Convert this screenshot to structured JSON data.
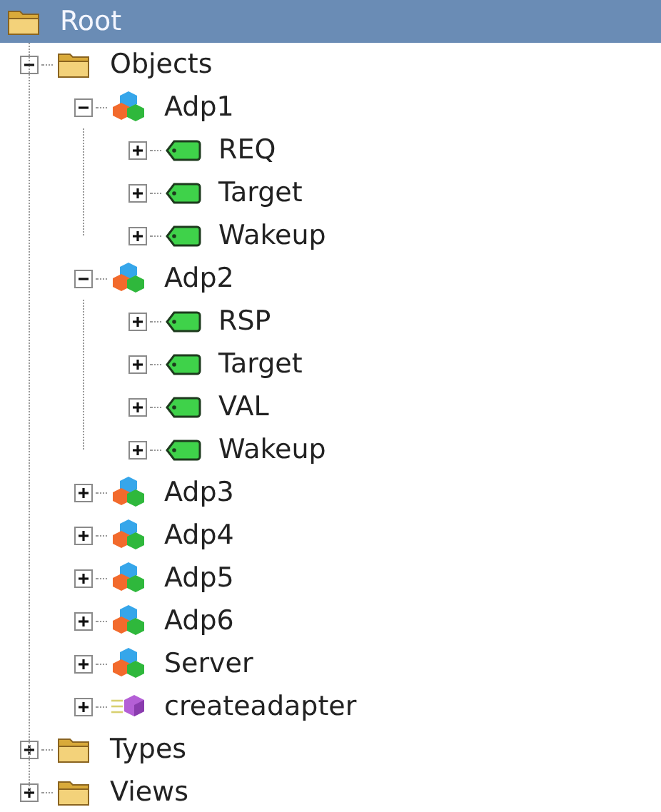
{
  "tree": {
    "label": "Root",
    "kind": "folder",
    "selected": true,
    "children": [
      {
        "label": "Objects",
        "kind": "folder",
        "selected": false,
        "expanded": true,
        "children": [
          {
            "label": "Adp1",
            "kind": "adapter",
            "selected": false,
            "expanded": true,
            "children": [
              {
                "label": "REQ",
                "kind": "tag",
                "selected": false,
                "expanded": false
              },
              {
                "label": "Target",
                "kind": "tag",
                "selected": false,
                "expanded": false
              },
              {
                "label": "Wakeup",
                "kind": "tag",
                "selected": false,
                "expanded": false
              }
            ]
          },
          {
            "label": "Adp2",
            "kind": "adapter",
            "selected": false,
            "expanded": true,
            "children": [
              {
                "label": "RSP",
                "kind": "tag",
                "selected": false,
                "expanded": false
              },
              {
                "label": "Target",
                "kind": "tag",
                "selected": false,
                "expanded": false
              },
              {
                "label": "VAL",
                "kind": "tag",
                "selected": false,
                "expanded": false
              },
              {
                "label": "Wakeup",
                "kind": "tag",
                "selected": false,
                "expanded": false
              }
            ]
          },
          {
            "label": "Adp3",
            "kind": "adapter",
            "selected": false,
            "expanded": false
          },
          {
            "label": "Adp4",
            "kind": "adapter",
            "selected": false,
            "expanded": false
          },
          {
            "label": "Adp5",
            "kind": "adapter",
            "selected": false,
            "expanded": false
          },
          {
            "label": "Adp6",
            "kind": "adapter",
            "selected": false,
            "expanded": false
          },
          {
            "label": "Server",
            "kind": "adapter",
            "selected": false,
            "expanded": false
          },
          {
            "label": "createadapter",
            "kind": "method",
            "selected": false,
            "expanded": false
          }
        ]
      },
      {
        "label": "Types",
        "kind": "folder",
        "selected": false,
        "expanded": false
      },
      {
        "label": "Views",
        "kind": "folder",
        "selected": false,
        "expanded": false
      }
    ]
  }
}
